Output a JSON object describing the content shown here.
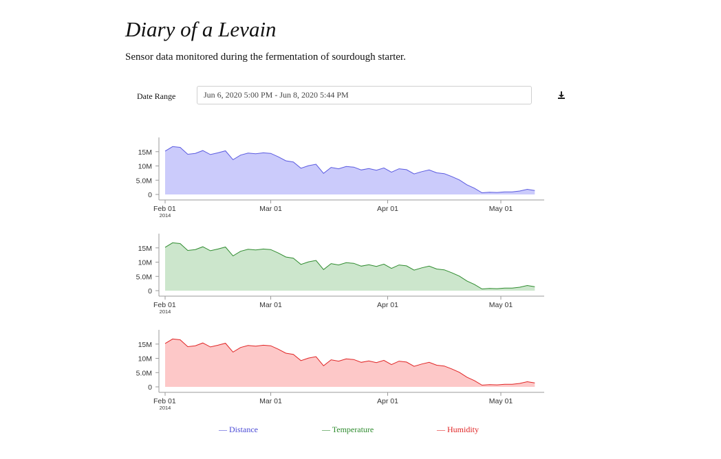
{
  "page": {
    "title": "Diary of a Levain",
    "subtitle": "Sensor data monitored during the fermentation of sourdough starter."
  },
  "controls": {
    "date_range_label": "Date Range",
    "date_range_value": "Jun 6, 2020 5:00 PM - Jun 8, 2020 5:44 PM",
    "download_icon": "download-icon"
  },
  "legend": [
    {
      "label": "— Distance",
      "color": "#4a4ad6"
    },
    {
      "label": "— Temperature",
      "color": "#2e8b2e"
    },
    {
      "label": "— Humidity",
      "color": "#e02424"
    }
  ],
  "chart_data": [
    {
      "type": "area",
      "series_name": "Distance",
      "stroke": "#5a5ae0",
      "fill": "#cbcbfb",
      "x": [
        "2014-02-01",
        "2014-02-03",
        "2014-02-05",
        "2014-02-07",
        "2014-02-09",
        "2014-02-11",
        "2014-02-13",
        "2014-02-15",
        "2014-02-17",
        "2014-02-19",
        "2014-02-21",
        "2014-02-23",
        "2014-02-25",
        "2014-02-27",
        "2014-03-01",
        "2014-03-03",
        "2014-03-05",
        "2014-03-07",
        "2014-03-09",
        "2014-03-11",
        "2014-03-13",
        "2014-03-15",
        "2014-03-17",
        "2014-03-19",
        "2014-03-21",
        "2014-03-23",
        "2014-03-25",
        "2014-03-27",
        "2014-03-29",
        "2014-03-31",
        "2014-04-02",
        "2014-04-04",
        "2014-04-06",
        "2014-04-08",
        "2014-04-10",
        "2014-04-12",
        "2014-04-14",
        "2014-04-16",
        "2014-04-18",
        "2014-04-20",
        "2014-04-22",
        "2014-04-24",
        "2014-04-26",
        "2014-04-28",
        "2014-04-30",
        "2014-05-02",
        "2014-05-04",
        "2014-05-06",
        "2014-05-08",
        "2014-05-10"
      ],
      "y": [
        15.2,
        16.8,
        16.5,
        14.1,
        14.4,
        15.4,
        14.0,
        14.6,
        15.3,
        12.2,
        13.8,
        14.5,
        14.3,
        14.6,
        14.4,
        13.2,
        11.8,
        11.4,
        9.2,
        10.1,
        10.6,
        7.4,
        9.5,
        9.0,
        9.8,
        9.6,
        8.6,
        9.1,
        8.5,
        9.3,
        7.8,
        9.0,
        8.7,
        7.2,
        8.0,
        8.6,
        7.6,
        7.3,
        6.3,
        5.1,
        3.4,
        2.2,
        0.6,
        0.8,
        0.7,
        0.9,
        0.9,
        1.2,
        1.8,
        1.4
      ],
      "xticks": [
        "Feb 01",
        "Mar 01",
        "Apr 01",
        "May 01"
      ],
      "xtick_subtext": "2014",
      "yticks": [
        "15M",
        "10M",
        "5.0M",
        "0"
      ],
      "ylim": [
        0,
        20
      ],
      "y_unit": "M"
    },
    {
      "type": "area",
      "series_name": "Temperature",
      "stroke": "#2e8b2e",
      "fill": "#cce6cc",
      "x": [
        "2014-02-01",
        "2014-02-03",
        "2014-02-05",
        "2014-02-07",
        "2014-02-09",
        "2014-02-11",
        "2014-02-13",
        "2014-02-15",
        "2014-02-17",
        "2014-02-19",
        "2014-02-21",
        "2014-02-23",
        "2014-02-25",
        "2014-02-27",
        "2014-03-01",
        "2014-03-03",
        "2014-03-05",
        "2014-03-07",
        "2014-03-09",
        "2014-03-11",
        "2014-03-13",
        "2014-03-15",
        "2014-03-17",
        "2014-03-19",
        "2014-03-21",
        "2014-03-23",
        "2014-03-25",
        "2014-03-27",
        "2014-03-29",
        "2014-03-31",
        "2014-04-02",
        "2014-04-04",
        "2014-04-06",
        "2014-04-08",
        "2014-04-10",
        "2014-04-12",
        "2014-04-14",
        "2014-04-16",
        "2014-04-18",
        "2014-04-20",
        "2014-04-22",
        "2014-04-24",
        "2014-04-26",
        "2014-04-28",
        "2014-04-30",
        "2014-05-02",
        "2014-05-04",
        "2014-05-06",
        "2014-05-08",
        "2014-05-10"
      ],
      "y": [
        15.2,
        16.8,
        16.5,
        14.1,
        14.4,
        15.4,
        14.0,
        14.6,
        15.3,
        12.2,
        13.8,
        14.5,
        14.3,
        14.6,
        14.4,
        13.2,
        11.8,
        11.4,
        9.2,
        10.1,
        10.6,
        7.4,
        9.5,
        9.0,
        9.8,
        9.6,
        8.6,
        9.1,
        8.5,
        9.3,
        7.8,
        9.0,
        8.7,
        7.2,
        8.0,
        8.6,
        7.6,
        7.3,
        6.3,
        5.1,
        3.4,
        2.2,
        0.6,
        0.8,
        0.7,
        0.9,
        0.9,
        1.2,
        1.8,
        1.4
      ],
      "xticks": [
        "Feb 01",
        "Mar 01",
        "Apr 01",
        "May 01"
      ],
      "xtick_subtext": "2014",
      "yticks": [
        "15M",
        "10M",
        "5.0M",
        "0"
      ],
      "ylim": [
        0,
        20
      ],
      "y_unit": "M"
    },
    {
      "type": "area",
      "series_name": "Humidity",
      "stroke": "#e02424",
      "fill": "#fdc8c8",
      "x": [
        "2014-02-01",
        "2014-02-03",
        "2014-02-05",
        "2014-02-07",
        "2014-02-09",
        "2014-02-11",
        "2014-02-13",
        "2014-02-15",
        "2014-02-17",
        "2014-02-19",
        "2014-02-21",
        "2014-02-23",
        "2014-02-25",
        "2014-02-27",
        "2014-03-01",
        "2014-03-03",
        "2014-03-05",
        "2014-03-07",
        "2014-03-09",
        "2014-03-11",
        "2014-03-13",
        "2014-03-15",
        "2014-03-17",
        "2014-03-19",
        "2014-03-21",
        "2014-03-23",
        "2014-03-25",
        "2014-03-27",
        "2014-03-29",
        "2014-03-31",
        "2014-04-02",
        "2014-04-04",
        "2014-04-06",
        "2014-04-08",
        "2014-04-10",
        "2014-04-12",
        "2014-04-14",
        "2014-04-16",
        "2014-04-18",
        "2014-04-20",
        "2014-04-22",
        "2014-04-24",
        "2014-04-26",
        "2014-04-28",
        "2014-04-30",
        "2014-05-02",
        "2014-05-04",
        "2014-05-06",
        "2014-05-08",
        "2014-05-10"
      ],
      "y": [
        15.2,
        16.8,
        16.5,
        14.1,
        14.4,
        15.4,
        14.0,
        14.6,
        15.3,
        12.2,
        13.8,
        14.5,
        14.3,
        14.6,
        14.4,
        13.2,
        11.8,
        11.4,
        9.2,
        10.1,
        10.6,
        7.4,
        9.5,
        9.0,
        9.8,
        9.6,
        8.6,
        9.1,
        8.5,
        9.3,
        7.8,
        9.0,
        8.7,
        7.2,
        8.0,
        8.6,
        7.6,
        7.3,
        6.3,
        5.1,
        3.4,
        2.2,
        0.6,
        0.8,
        0.7,
        0.9,
        0.9,
        1.2,
        1.8,
        1.4
      ],
      "xticks": [
        "Feb 01",
        "Mar 01",
        "Apr 01",
        "May 01"
      ],
      "xtick_subtext": "2014",
      "yticks": [
        "15M",
        "10M",
        "5.0M",
        "0"
      ],
      "ylim": [
        0,
        20
      ],
      "y_unit": "M"
    }
  ]
}
